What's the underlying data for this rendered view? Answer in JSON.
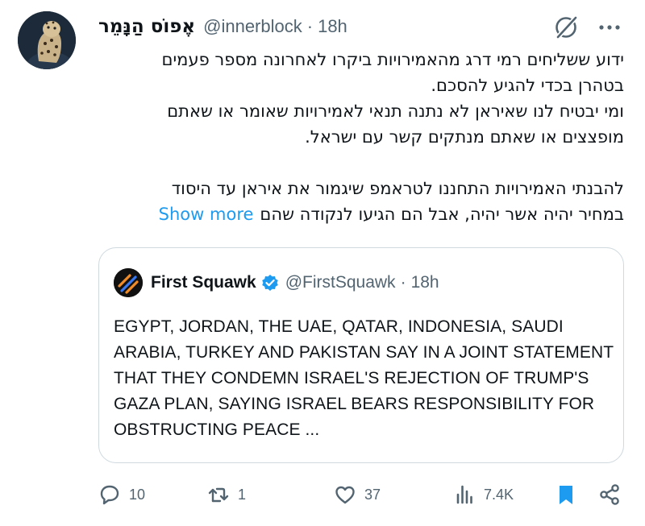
{
  "post": {
    "display_name": "אֶפוֹס הַנָּמֵר",
    "handle": "@innerblock",
    "separator": "·",
    "time": "18h",
    "text_lines": [
      "ידוע ששליחים רמי דרג מהאמירויות ביקרו לאחרונה מספר פעמים",
      "בטהרן בכדי להגיע להסכם.",
      "ומי יבטיח לנו שאיראן לא נתנה תנאי לאמירויות שאומר או שאתם",
      "מופצצים או שאתם מנתקים קשר עם ישראל.",
      "להבנתי האמירויות התחננו לטראמפ שיגמור את איראן עד היסוד",
      "במחיר יהיה אשר יהיה, אבל הם הגיעו לנקודה שהם"
    ],
    "show_more": "Show more"
  },
  "quote": {
    "display_name": "First Squawk",
    "handle": "@FirstSquawk",
    "separator": "·",
    "time": "18h",
    "text": "EGYPT, JORDAN, THE UAE, QATAR, INDONESIA, SAUDI ARABIA, TURKEY AND PAKISTAN SAY IN A JOINT STATEMENT THAT THEY CONDEMN ISRAEL'S REJECTION OF TRUMP'S GAZA PLAN, SAYING ISRAEL BEARS RESPONSIBILITY FOR OBSTRUCTING PEACE ..."
  },
  "actions": {
    "replies": "10",
    "reposts": "1",
    "likes": "37",
    "views": "7.4K"
  },
  "icons": {
    "grok": "grok-slash-icon",
    "more": "more-dots-icon",
    "verified": "verified-badge-icon",
    "reply": "reply-bubble-icon",
    "repost": "repost-arrows-icon",
    "like": "heart-icon",
    "views": "views-bars-icon",
    "bookmark": "bookmark-icon",
    "share": "share-icon"
  },
  "colors": {
    "link": "#1d9bf0",
    "secondary_text": "#536471",
    "primary_text": "#0f1419",
    "border": "#cfd9de",
    "bookmark_active": "#1d9bf0"
  }
}
